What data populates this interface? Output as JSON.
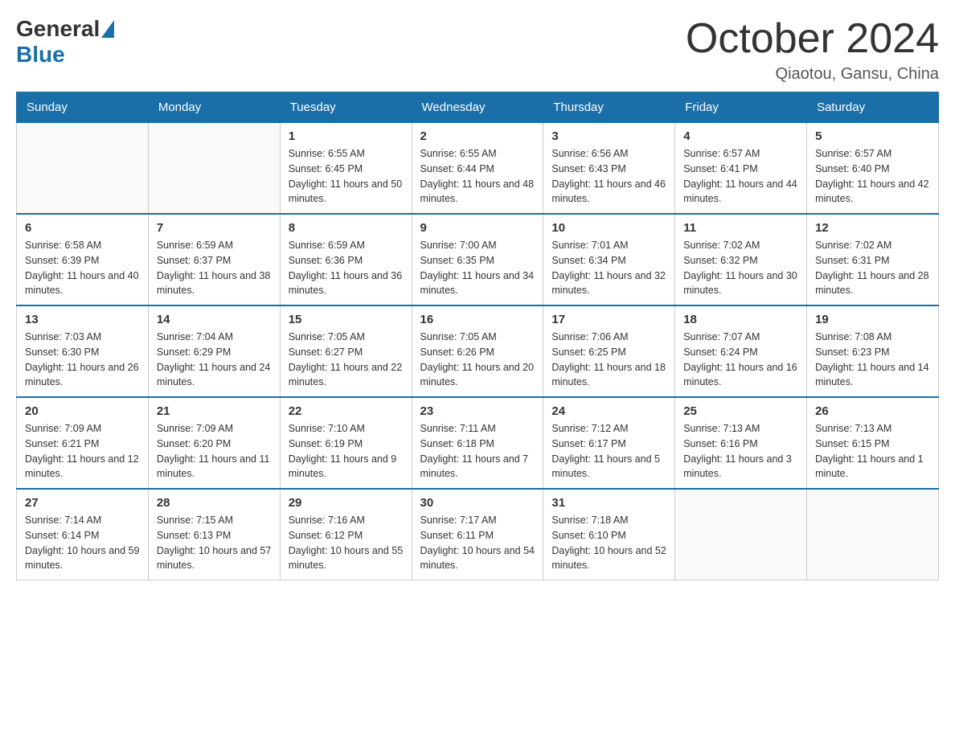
{
  "header": {
    "logo_general": "General",
    "logo_blue": "Blue",
    "month_title": "October 2024",
    "location": "Qiaotou, Gansu, China"
  },
  "days_of_week": [
    "Sunday",
    "Monday",
    "Tuesday",
    "Wednesday",
    "Thursday",
    "Friday",
    "Saturday"
  ],
  "weeks": [
    [
      {
        "day": "",
        "sunrise": "",
        "sunset": "",
        "daylight": ""
      },
      {
        "day": "",
        "sunrise": "",
        "sunset": "",
        "daylight": ""
      },
      {
        "day": "1",
        "sunrise": "Sunrise: 6:55 AM",
        "sunset": "Sunset: 6:45 PM",
        "daylight": "Daylight: 11 hours and 50 minutes."
      },
      {
        "day": "2",
        "sunrise": "Sunrise: 6:55 AM",
        "sunset": "Sunset: 6:44 PM",
        "daylight": "Daylight: 11 hours and 48 minutes."
      },
      {
        "day": "3",
        "sunrise": "Sunrise: 6:56 AM",
        "sunset": "Sunset: 6:43 PM",
        "daylight": "Daylight: 11 hours and 46 minutes."
      },
      {
        "day": "4",
        "sunrise": "Sunrise: 6:57 AM",
        "sunset": "Sunset: 6:41 PM",
        "daylight": "Daylight: 11 hours and 44 minutes."
      },
      {
        "day": "5",
        "sunrise": "Sunrise: 6:57 AM",
        "sunset": "Sunset: 6:40 PM",
        "daylight": "Daylight: 11 hours and 42 minutes."
      }
    ],
    [
      {
        "day": "6",
        "sunrise": "Sunrise: 6:58 AM",
        "sunset": "Sunset: 6:39 PM",
        "daylight": "Daylight: 11 hours and 40 minutes."
      },
      {
        "day": "7",
        "sunrise": "Sunrise: 6:59 AM",
        "sunset": "Sunset: 6:37 PM",
        "daylight": "Daylight: 11 hours and 38 minutes."
      },
      {
        "day": "8",
        "sunrise": "Sunrise: 6:59 AM",
        "sunset": "Sunset: 6:36 PM",
        "daylight": "Daylight: 11 hours and 36 minutes."
      },
      {
        "day": "9",
        "sunrise": "Sunrise: 7:00 AM",
        "sunset": "Sunset: 6:35 PM",
        "daylight": "Daylight: 11 hours and 34 minutes."
      },
      {
        "day": "10",
        "sunrise": "Sunrise: 7:01 AM",
        "sunset": "Sunset: 6:34 PM",
        "daylight": "Daylight: 11 hours and 32 minutes."
      },
      {
        "day": "11",
        "sunrise": "Sunrise: 7:02 AM",
        "sunset": "Sunset: 6:32 PM",
        "daylight": "Daylight: 11 hours and 30 minutes."
      },
      {
        "day": "12",
        "sunrise": "Sunrise: 7:02 AM",
        "sunset": "Sunset: 6:31 PM",
        "daylight": "Daylight: 11 hours and 28 minutes."
      }
    ],
    [
      {
        "day": "13",
        "sunrise": "Sunrise: 7:03 AM",
        "sunset": "Sunset: 6:30 PM",
        "daylight": "Daylight: 11 hours and 26 minutes."
      },
      {
        "day": "14",
        "sunrise": "Sunrise: 7:04 AM",
        "sunset": "Sunset: 6:29 PM",
        "daylight": "Daylight: 11 hours and 24 minutes."
      },
      {
        "day": "15",
        "sunrise": "Sunrise: 7:05 AM",
        "sunset": "Sunset: 6:27 PM",
        "daylight": "Daylight: 11 hours and 22 minutes."
      },
      {
        "day": "16",
        "sunrise": "Sunrise: 7:05 AM",
        "sunset": "Sunset: 6:26 PM",
        "daylight": "Daylight: 11 hours and 20 minutes."
      },
      {
        "day": "17",
        "sunrise": "Sunrise: 7:06 AM",
        "sunset": "Sunset: 6:25 PM",
        "daylight": "Daylight: 11 hours and 18 minutes."
      },
      {
        "day": "18",
        "sunrise": "Sunrise: 7:07 AM",
        "sunset": "Sunset: 6:24 PM",
        "daylight": "Daylight: 11 hours and 16 minutes."
      },
      {
        "day": "19",
        "sunrise": "Sunrise: 7:08 AM",
        "sunset": "Sunset: 6:23 PM",
        "daylight": "Daylight: 11 hours and 14 minutes."
      }
    ],
    [
      {
        "day": "20",
        "sunrise": "Sunrise: 7:09 AM",
        "sunset": "Sunset: 6:21 PM",
        "daylight": "Daylight: 11 hours and 12 minutes."
      },
      {
        "day": "21",
        "sunrise": "Sunrise: 7:09 AM",
        "sunset": "Sunset: 6:20 PM",
        "daylight": "Daylight: 11 hours and 11 minutes."
      },
      {
        "day": "22",
        "sunrise": "Sunrise: 7:10 AM",
        "sunset": "Sunset: 6:19 PM",
        "daylight": "Daylight: 11 hours and 9 minutes."
      },
      {
        "day": "23",
        "sunrise": "Sunrise: 7:11 AM",
        "sunset": "Sunset: 6:18 PM",
        "daylight": "Daylight: 11 hours and 7 minutes."
      },
      {
        "day": "24",
        "sunrise": "Sunrise: 7:12 AM",
        "sunset": "Sunset: 6:17 PM",
        "daylight": "Daylight: 11 hours and 5 minutes."
      },
      {
        "day": "25",
        "sunrise": "Sunrise: 7:13 AM",
        "sunset": "Sunset: 6:16 PM",
        "daylight": "Daylight: 11 hours and 3 minutes."
      },
      {
        "day": "26",
        "sunrise": "Sunrise: 7:13 AM",
        "sunset": "Sunset: 6:15 PM",
        "daylight": "Daylight: 11 hours and 1 minute."
      }
    ],
    [
      {
        "day": "27",
        "sunrise": "Sunrise: 7:14 AM",
        "sunset": "Sunset: 6:14 PM",
        "daylight": "Daylight: 10 hours and 59 minutes."
      },
      {
        "day": "28",
        "sunrise": "Sunrise: 7:15 AM",
        "sunset": "Sunset: 6:13 PM",
        "daylight": "Daylight: 10 hours and 57 minutes."
      },
      {
        "day": "29",
        "sunrise": "Sunrise: 7:16 AM",
        "sunset": "Sunset: 6:12 PM",
        "daylight": "Daylight: 10 hours and 55 minutes."
      },
      {
        "day": "30",
        "sunrise": "Sunrise: 7:17 AM",
        "sunset": "Sunset: 6:11 PM",
        "daylight": "Daylight: 10 hours and 54 minutes."
      },
      {
        "day": "31",
        "sunrise": "Sunrise: 7:18 AM",
        "sunset": "Sunset: 6:10 PM",
        "daylight": "Daylight: 10 hours and 52 minutes."
      },
      {
        "day": "",
        "sunrise": "",
        "sunset": "",
        "daylight": ""
      },
      {
        "day": "",
        "sunrise": "",
        "sunset": "",
        "daylight": ""
      }
    ]
  ]
}
